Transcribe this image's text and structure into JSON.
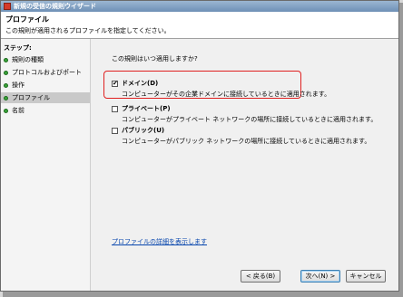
{
  "window": {
    "title": "新規の受信の規則ウイザード"
  },
  "header": {
    "title": "プロファイル",
    "subtitle": "この規則が適用されるプロファイルを指定してください。"
  },
  "sidebar": {
    "title": "ステップ:",
    "items": [
      {
        "label": "規則の種類"
      },
      {
        "label": "プロトコルおよびポート"
      },
      {
        "label": "操作"
      },
      {
        "label": "プロファイル"
      },
      {
        "label": "名前"
      }
    ],
    "active_index": 3
  },
  "main": {
    "question": "この規則はいつ適用しますか?",
    "options": [
      {
        "label": "ドメイン(D)",
        "description": "コンピューターがその企業ドメインに接続しているときに適用されます。",
        "checked": true
      },
      {
        "label": "プライベート(P)",
        "description": "コンピューターがプライベート ネットワークの場所に接続しているときに適用されます。",
        "checked": false
      },
      {
        "label": "パブリック(U)",
        "description": "コンピューターがパブリック ネットワークの場所に接続しているときに適用されます。",
        "checked": false
      }
    ],
    "link": "プロファイルの詳細を表示します"
  },
  "buttons": {
    "back": "< 戻る(B)",
    "next": "次へ(N) >",
    "cancel": "キャンセル"
  },
  "colors": {
    "highlight": "#e02020",
    "link": "#0645ad",
    "step_dot": "#3aa33a"
  },
  "icons": {
    "checked": "✔"
  }
}
